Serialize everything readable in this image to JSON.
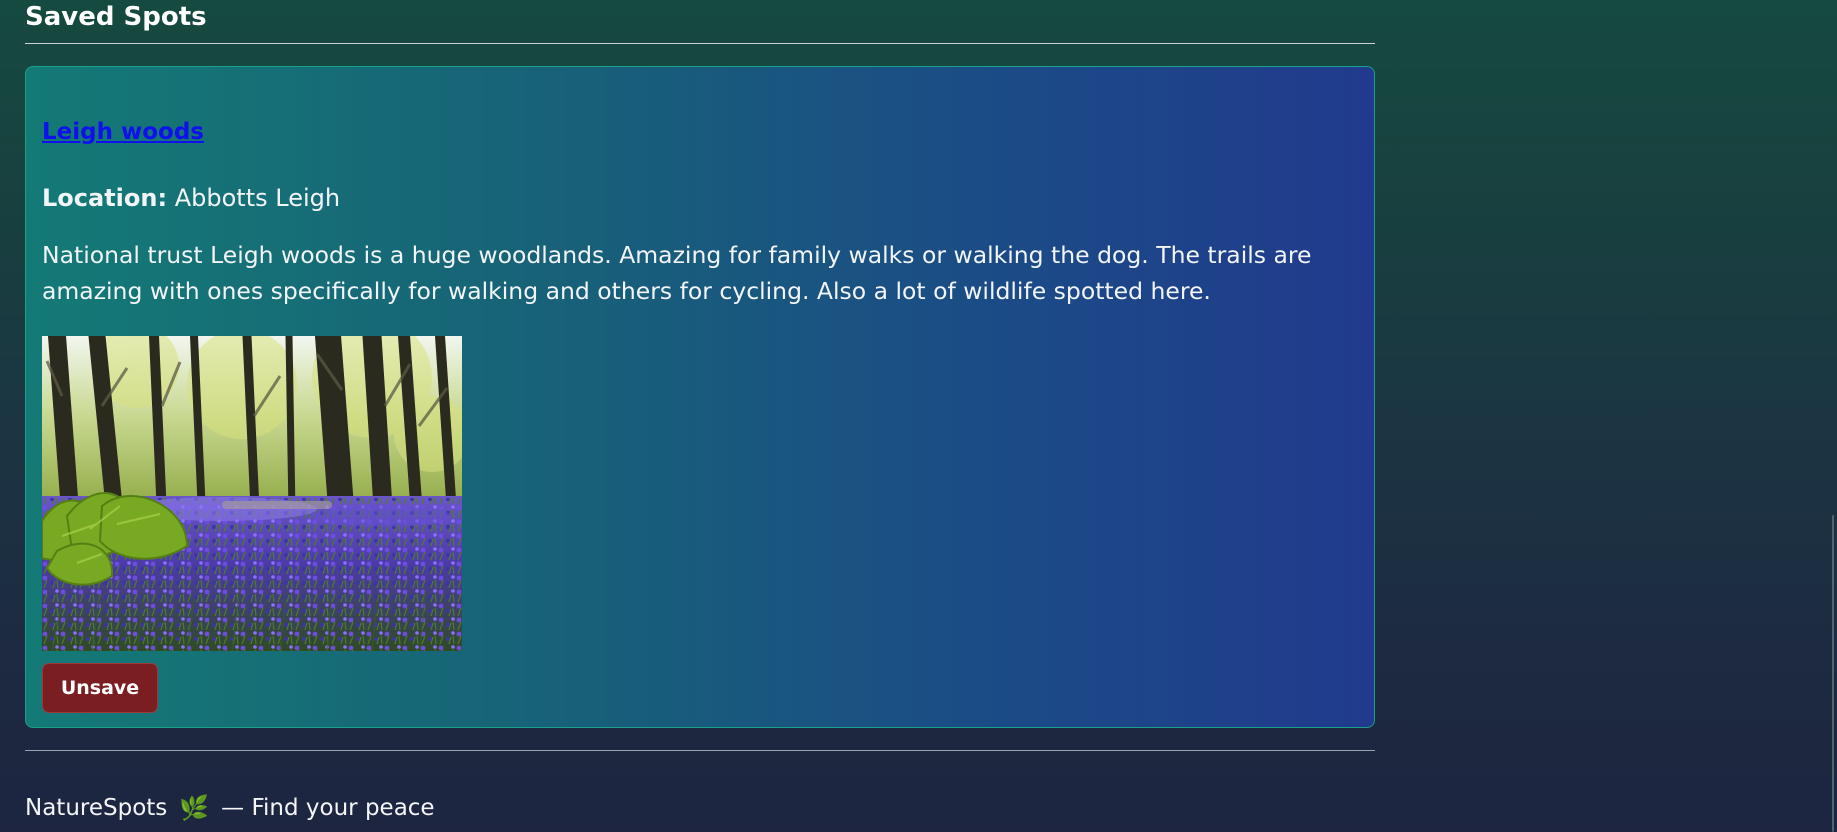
{
  "page": {
    "section_title": "Saved Spots"
  },
  "spot": {
    "title": "Leigh woods",
    "location_label": "Location:",
    "location_value": "Abbotts Leigh",
    "description": "National trust Leigh woods is a huge woodlands. Amazing for family walks or walking the dog. The trails are amazing with ones specifically for walking and others for cycling. Also a lot of wildlife spotted here.",
    "image_icon": "bluebell-woodland-photo",
    "unsave_label": "Unsave"
  },
  "footer": {
    "brand": "NatureSpots",
    "icon": "leaf-icon",
    "tagline": "— Find your peace"
  },
  "colors": {
    "background_top": "#154a40",
    "background_bottom": "#1d2540",
    "card_start": "#147a76",
    "card_end": "#213a8d",
    "link": "#1010ee",
    "unsave_button": "#7b1e22",
    "border_accent": "#1aa189"
  }
}
